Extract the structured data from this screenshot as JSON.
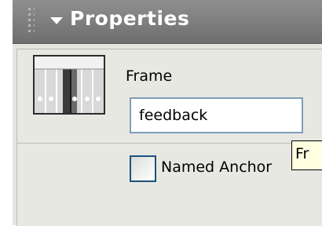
{
  "panel": {
    "title": "Properties",
    "collapse_icon": "triangle-down-icon",
    "grip_icon": "drag-grip-icon"
  },
  "frame": {
    "label": "Frame",
    "value": "feedback",
    "thumbnail_icon": "frame-timeline-icon"
  },
  "anchor": {
    "label": "Named Anchor",
    "checked": false
  },
  "tooltip": {
    "text": "Fr"
  }
}
